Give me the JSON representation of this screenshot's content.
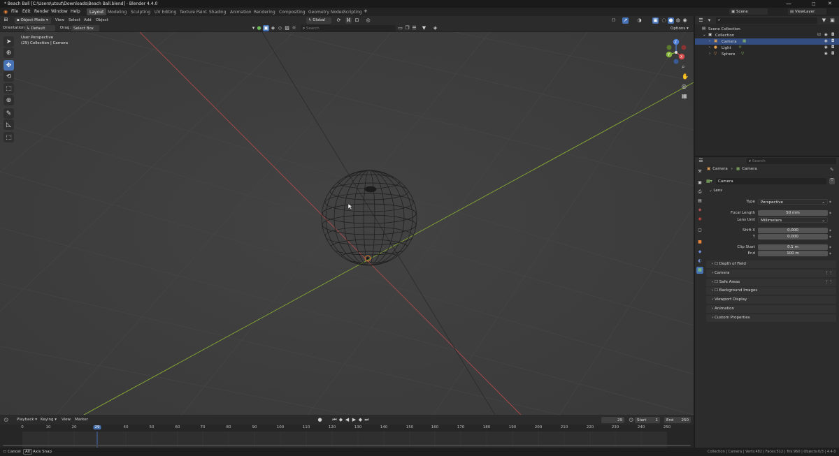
{
  "window": {
    "title": "* Beach Ball [C:\\Users\\utsut\\Downloads\\Beach Ball.blend] - Blender 4.4.0",
    "minimize": "—",
    "maximize": "□",
    "close": "✕"
  },
  "menu": [
    "File",
    "Edit",
    "Render",
    "Window",
    "Help"
  ],
  "workspaces": [
    "Layout",
    "Modeling",
    "Sculpting",
    "UV Editing",
    "Texture Paint",
    "Shading",
    "Animation",
    "Rendering",
    "Compositing",
    "Geometry Nodes",
    "Scripting"
  ],
  "add_workspace": "+",
  "scene": {
    "name": "Scene",
    "view_layer": "ViewLayer"
  },
  "viewport_header": {
    "mode": "Object Mode",
    "view": "View",
    "select": "Select",
    "add": "Add",
    "object": "Object",
    "orientation": "Global",
    "options": "Options"
  },
  "tool_settings": {
    "orientation_label": "Orientation:",
    "orientation_value": "Default",
    "drag_label": "Drag:",
    "drag_value": "Select Box",
    "search_placeholder": "Search"
  },
  "viewport_info": {
    "line1": "User Perspective",
    "line2": "(29) Collection | Camera"
  },
  "gizmo": {
    "x": "X",
    "y": "Y",
    "z": "Z"
  },
  "colors": {
    "x_axis": "#b04a4a",
    "y_axis": "#86a833",
    "accent": "#4772b3",
    "selection": "#334d80"
  },
  "outliner": {
    "scene_collection": "Scene Collection",
    "collection": "Collection",
    "items": [
      {
        "name": "Camera",
        "icon": "camera-icon",
        "selected": true
      },
      {
        "name": "Light",
        "icon": "light-icon",
        "selected": false
      },
      {
        "name": "Sphere",
        "icon": "mesh-icon",
        "selected": false
      }
    ]
  },
  "properties": {
    "search_placeholder": "Search",
    "breadcrumb_object": "Camera",
    "breadcrumb_data": "Camera",
    "data_name": "Camera",
    "lens_panel": "Lens",
    "type_label": "Type",
    "type_value": "Perspective",
    "focal_length_label": "Focal Length",
    "focal_length_value": "50 mm",
    "lens_unit_label": "Lens Unit",
    "lens_unit_value": "Millimeters",
    "shift_x_label": "Shift X",
    "shift_x_value": "0.000",
    "shift_y_label": "Y",
    "shift_y_value": "0.000",
    "clip_start_label": "Clip Start",
    "clip_start_value": "0.1 m",
    "clip_end_label": "End",
    "clip_end_value": "100 m",
    "panels": [
      "Depth of Field",
      "Camera",
      "Safe Areas",
      "Background Images",
      "Viewport Display",
      "Animation",
      "Custom Properties"
    ]
  },
  "timeline": {
    "playback": "Playback",
    "keying": "Keying",
    "view": "View",
    "marker": "Marker",
    "current_frame": "29",
    "start_label": "Start",
    "start_value": "1",
    "end_label": "End",
    "end_value": "250",
    "ticks": [
      "0",
      "10",
      "20",
      "29",
      "40",
      "50",
      "60",
      "70",
      "80",
      "90",
      "100",
      "110",
      "120",
      "130",
      "140",
      "150",
      "160",
      "170",
      "180",
      "190",
      "200",
      "210",
      "220",
      "230",
      "240",
      "250"
    ]
  },
  "status": {
    "left_cancel": "Cancel",
    "left_alt": "Alt",
    "left_axis_snap": "Axis Snap",
    "right": "Collection | Camera | Verts:482 | Faces:512 | Tris:960 | Objects:0/3 | 4.4.0"
  }
}
